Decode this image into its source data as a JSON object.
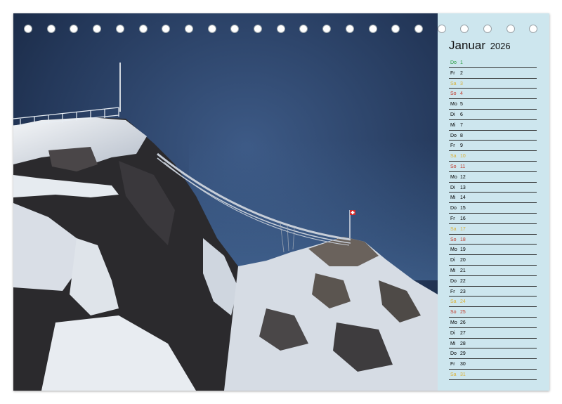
{
  "calendar": {
    "month": "Januar",
    "year": "2026",
    "days": [
      {
        "wd": "Do",
        "d": "1",
        "kind": "holiday"
      },
      {
        "wd": "Fr",
        "d": "2",
        "kind": "normal"
      },
      {
        "wd": "Sa",
        "d": "3",
        "kind": "sa"
      },
      {
        "wd": "So",
        "d": "4",
        "kind": "so"
      },
      {
        "wd": "Mo",
        "d": "5",
        "kind": "normal"
      },
      {
        "wd": "Di",
        "d": "6",
        "kind": "normal"
      },
      {
        "wd": "Mi",
        "d": "7",
        "kind": "normal"
      },
      {
        "wd": "Do",
        "d": "8",
        "kind": "normal"
      },
      {
        "wd": "Fr",
        "d": "9",
        "kind": "normal"
      },
      {
        "wd": "Sa",
        "d": "10",
        "kind": "sa"
      },
      {
        "wd": "So",
        "d": "11",
        "kind": "so"
      },
      {
        "wd": "Mo",
        "d": "12",
        "kind": "normal"
      },
      {
        "wd": "Di",
        "d": "13",
        "kind": "normal"
      },
      {
        "wd": "Mi",
        "d": "14",
        "kind": "normal"
      },
      {
        "wd": "Do",
        "d": "15",
        "kind": "normal"
      },
      {
        "wd": "Fr",
        "d": "16",
        "kind": "normal"
      },
      {
        "wd": "Sa",
        "d": "17",
        "kind": "sa"
      },
      {
        "wd": "So",
        "d": "18",
        "kind": "so"
      },
      {
        "wd": "Mo",
        "d": "19",
        "kind": "normal"
      },
      {
        "wd": "Di",
        "d": "20",
        "kind": "normal"
      },
      {
        "wd": "Mi",
        "d": "21",
        "kind": "normal"
      },
      {
        "wd": "Do",
        "d": "22",
        "kind": "normal"
      },
      {
        "wd": "Fr",
        "d": "23",
        "kind": "normal"
      },
      {
        "wd": "Sa",
        "d": "24",
        "kind": "sa"
      },
      {
        "wd": "So",
        "d": "25",
        "kind": "so"
      },
      {
        "wd": "Mo",
        "d": "26",
        "kind": "normal"
      },
      {
        "wd": "Di",
        "d": "27",
        "kind": "normal"
      },
      {
        "wd": "Mi",
        "d": "28",
        "kind": "normal"
      },
      {
        "wd": "Do",
        "d": "29",
        "kind": "normal"
      },
      {
        "wd": "Fr",
        "d": "30",
        "kind": "normal"
      },
      {
        "wd": "Sa",
        "d": "31",
        "kind": "sa"
      }
    ]
  },
  "colors": {
    "sidebar": "#cde6ee",
    "holiday": "#1f9a3a",
    "saturday": "#d9b23a",
    "sunday": "#c0392b",
    "sky": "#24385a"
  },
  "photo": {
    "flag_icon": "swiss-flag-icon"
  }
}
